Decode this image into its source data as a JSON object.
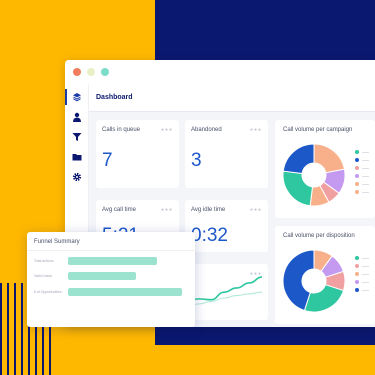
{
  "colors": {
    "brand_navy": "#0B1870",
    "accent_yellow": "#FFB800",
    "value_blue": "#1D58C9",
    "chart_navy": "#1D58C9",
    "chart_teal": "#2FC7A0",
    "chart_peach": "#F8B08A",
    "chart_purple": "#C49AF0",
    "chart_pink": "#F0A0A0"
  },
  "window": {
    "controls": [
      "close",
      "minimize",
      "maximize"
    ]
  },
  "sidebar": {
    "items": [
      {
        "icon": "layers-icon",
        "active": true
      },
      {
        "icon": "user-icon",
        "active": false
      },
      {
        "icon": "filter-icon",
        "active": false
      },
      {
        "icon": "folder-icon",
        "active": false
      },
      {
        "icon": "gear-icon",
        "active": false
      }
    ]
  },
  "header": {
    "title": "Dashboard"
  },
  "kpis": [
    {
      "label": "Calls in queue",
      "value": "7"
    },
    {
      "label": "Abandoned",
      "value": "3"
    },
    {
      "label": "Avg call time",
      "value": "5:21"
    },
    {
      "label": "Avg idle time",
      "value": "0:32"
    }
  ],
  "campaign_chart": {
    "title": "Call volume per campaign",
    "slices": [
      {
        "value": 22,
        "color": "#F8B08A"
      },
      {
        "value": 13,
        "color": "#C49AF0"
      },
      {
        "value": 7,
        "color": "#F0A0A0"
      },
      {
        "value": 10,
        "color": "#F8B08A"
      },
      {
        "value": 25,
        "color": "#2FC7A0"
      },
      {
        "value": 23,
        "color": "#1D58C9"
      }
    ],
    "legend_colors": [
      "#2FC7A0",
      "#1D58C9",
      "#F0A0A0",
      "#C49AF0",
      "#F8B08A",
      "#F8B08A"
    ]
  },
  "disposition_chart": {
    "title": "Call volume per disposition",
    "slices": [
      {
        "value": 10,
        "color": "#F8B08A"
      },
      {
        "value": 10,
        "color": "#C49AF0"
      },
      {
        "value": 10,
        "color": "#F0A0A0"
      },
      {
        "value": 25,
        "color": "#2FC7A0"
      },
      {
        "value": 45,
        "color": "#1D58C9"
      }
    ],
    "legend_colors": [
      "#2FC7A0",
      "#F0A0A0",
      "#F8B08A",
      "#C49AF0",
      "#1D58C9"
    ]
  },
  "trend_chart": {
    "series": [
      {
        "color": "#2FC7A0",
        "values": [
          30,
          36,
          34,
          52,
          62,
          74,
          88
        ]
      },
      {
        "color": "#B8EADC",
        "values": [
          18,
          24,
          30,
          38,
          44,
          48,
          52
        ]
      }
    ]
  },
  "funnel": {
    "title": "Funnel Summary",
    "rows": [
      {
        "label": "Total actions",
        "fraction": 0.78
      },
      {
        "label": "Valid Leads",
        "fraction": 0.6
      },
      {
        "label": "# of Opportunities",
        "fraction": 1.0
      }
    ]
  }
}
